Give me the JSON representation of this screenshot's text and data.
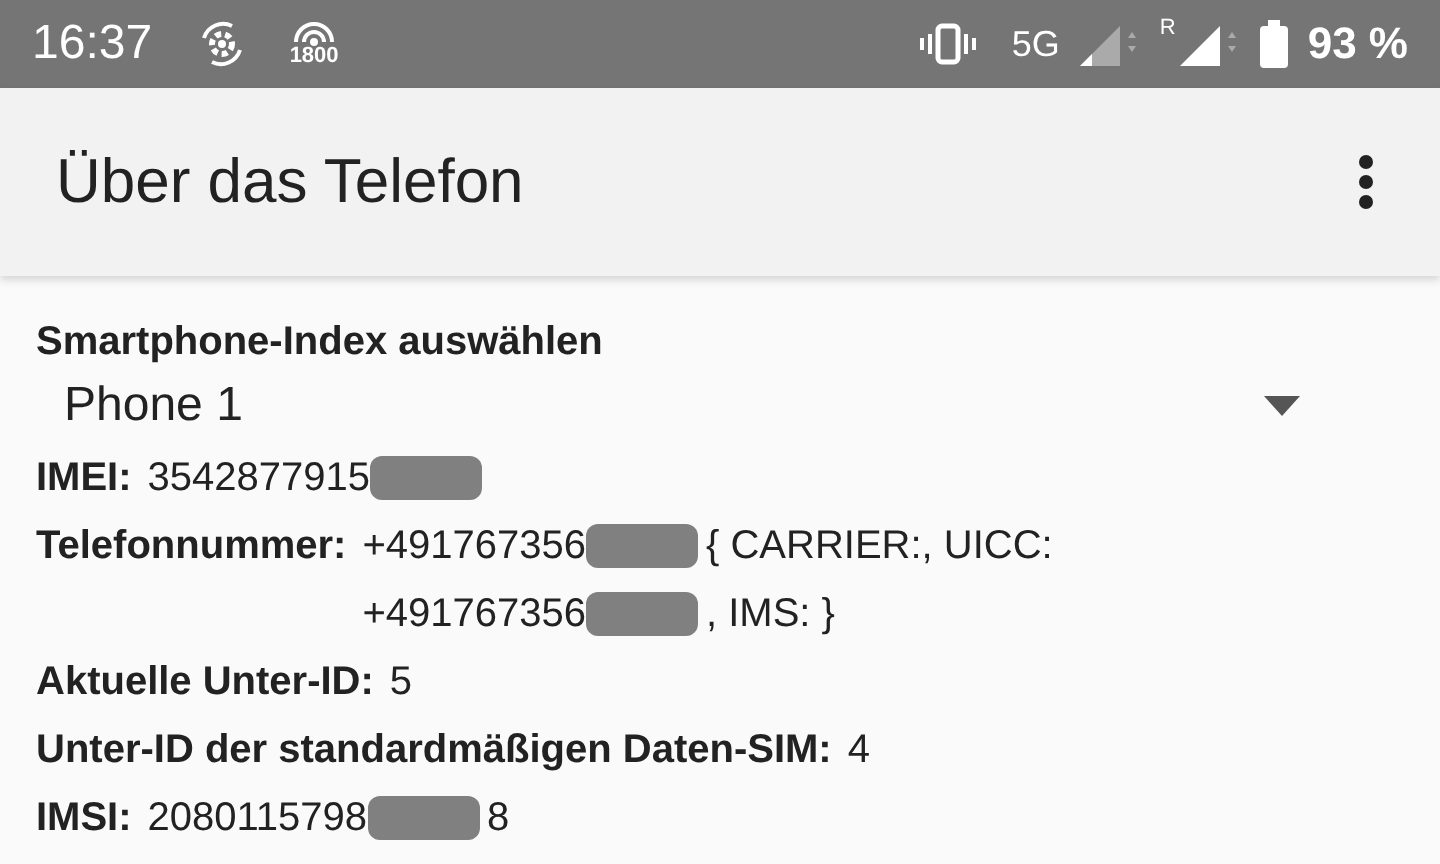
{
  "status_bar": {
    "time": "16:37",
    "network_badge": "1800",
    "network_type": "5G",
    "roaming": "R",
    "battery": "93 %"
  },
  "app_bar": {
    "title": "Über das Telefon"
  },
  "phone_index": {
    "label": "Smartphone-Index auswählen",
    "value": "Phone 1"
  },
  "fields": [
    {
      "label": "IMEI:",
      "value": [
        {
          "kind": "text",
          "text": "3542877915"
        },
        {
          "kind": "redacted"
        }
      ]
    },
    {
      "label": "Telefonnummer:",
      "value": [
        {
          "kind": "text",
          "text": "+491767356"
        },
        {
          "kind": "redacted"
        },
        {
          "kind": "text",
          "text": "{ CARRIER:, UICC:"
        },
        {
          "kind": "break"
        },
        {
          "kind": "text",
          "text": "+491767356"
        },
        {
          "kind": "redacted"
        },
        {
          "kind": "text",
          "text": ", IMS: }"
        }
      ]
    },
    {
      "label": "Aktuelle Unter-ID:",
      "value": [
        {
          "kind": "text",
          "text": "5"
        }
      ]
    },
    {
      "label": "Unter-ID der standardmäßigen Daten-SIM:",
      "value": [
        {
          "kind": "text",
          "text": "4"
        }
      ]
    },
    {
      "label": "IMSI:",
      "value": [
        {
          "kind": "text",
          "text": "2080115798"
        },
        {
          "kind": "redacted"
        },
        {
          "kind": "text",
          "text": "8"
        }
      ]
    }
  ]
}
